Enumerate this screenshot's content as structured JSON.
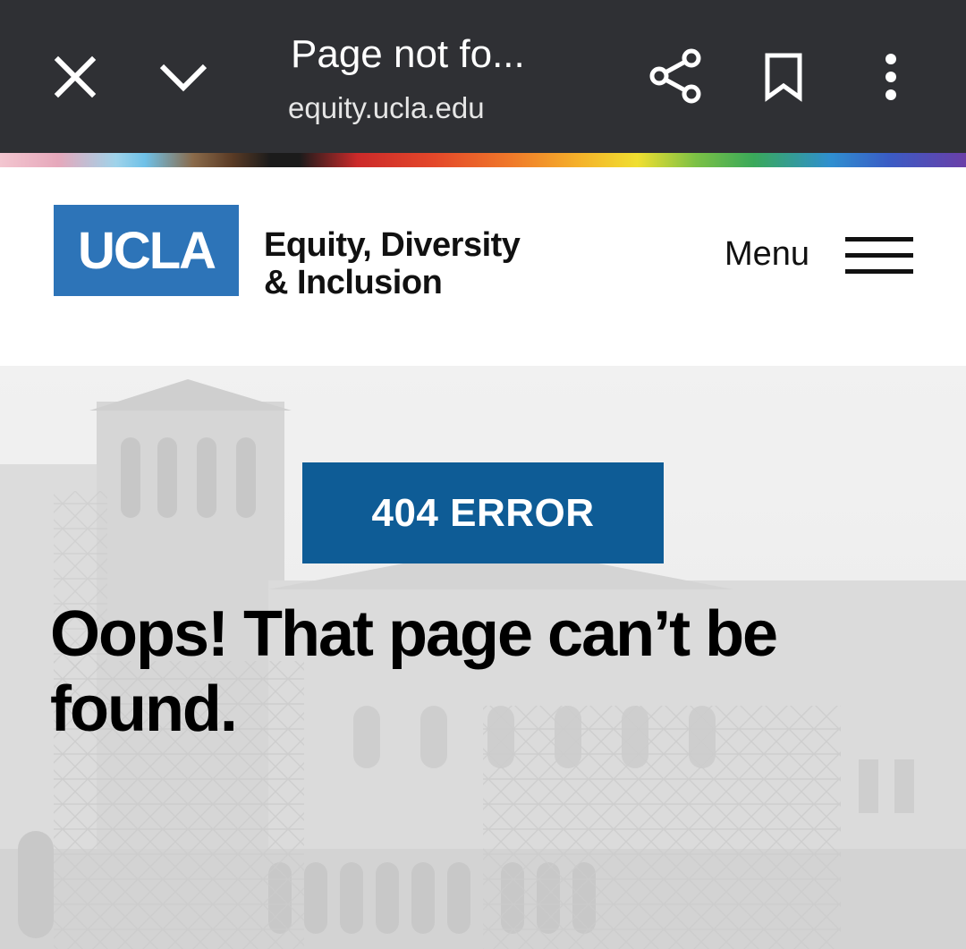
{
  "browser": {
    "title": "Page not fo...",
    "url": "equity.ucla.edu",
    "icons": [
      "close-icon",
      "chevron-down-icon",
      "share-icon",
      "bookmark-icon",
      "more-vert-icon"
    ]
  },
  "site": {
    "logo_text": "UCLA",
    "name_line1": "Equity, Diversity",
    "name_line2": "& Inclusion",
    "menu_label": "Menu",
    "colors": {
      "logo_blue": "#2d74b8",
      "badge_blue": "#0e5c96"
    }
  },
  "error": {
    "badge": "404 ERROR",
    "headline": "Oops! That page can’t be found."
  }
}
